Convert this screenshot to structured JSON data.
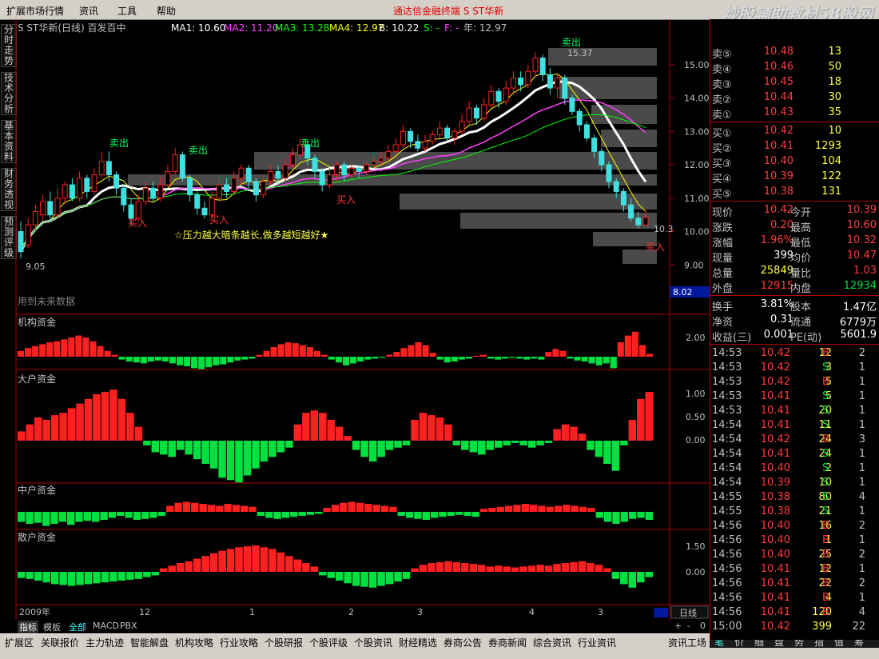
{
  "menu": {
    "items": [
      "扩展市场行情",
      "资讯",
      "工具",
      "帮助"
    ],
    "title": "通达信金融终端  S  ST华新",
    "watermark": "炒股辅助教材58股网",
    "watermark_url": "www.58Gu.com"
  },
  "left_tabs": [
    "分时走势",
    "技术分析",
    "基本资料",
    "财务透视",
    "预测评级"
  ],
  "header": {
    "stock": "S ST华新(日线) 百发百中",
    "ma1": "MA1: 10.60",
    "ma2": "MA2: 11.20",
    "ma3": "MA3: 13.28",
    "ma4": "MA4: 12.97",
    "b": "B: 10.22",
    "s": "S: -",
    "f": "F: -",
    "year": "年: 12.97"
  },
  "main_chart": {
    "price_axis": [
      "15.00",
      "14.00",
      "13.00",
      "12.00",
      "11.00",
      "10.00",
      "9.00",
      "8.00"
    ],
    "current_price_box": "8.02",
    "high_label": "15.37",
    "low_label": "9.05",
    "last_label": "10.3",
    "sell_label": "卖出",
    "buy_label": "买入",
    "slogan": "☆压力越大暗条越长,做多越短越好★",
    "future_note": "用到未来数据"
  },
  "indicators": [
    {
      "name": "机构资金",
      "axis": [
        "2.00"
      ]
    },
    {
      "name": "大户资金",
      "axis": [
        "1.00",
        "0.50",
        "0.00"
      ]
    },
    {
      "name": "中户资金",
      "axis": []
    },
    {
      "name": "散户资金",
      "axis": [
        "1.50",
        "0.00"
      ]
    }
  ],
  "time_axis": [
    "2009年",
    "12",
    "1",
    "2",
    "3",
    "4",
    "3"
  ],
  "period_label": "日线",
  "zoom": [
    "+",
    "-",
    "0"
  ],
  "bottom_tabs": [
    "指标",
    "模板",
    "全部",
    "MACD",
    "PBX"
  ],
  "func_bar": [
    "扩展区",
    "关联报价",
    "主力轨迹",
    "智能解盘",
    "机构攻略",
    "行业攻略",
    "个股研报",
    "个股评级",
    "个股资讯",
    "财经精选",
    "券商公告",
    "券商新闻",
    "综合资讯",
    "行业资讯",
    "资讯工场"
  ],
  "panel_tabs": [
    "笔",
    "价",
    "细",
    "盘",
    "势",
    "指",
    "值",
    "筹"
  ],
  "order_book": {
    "sell": [
      {
        "label": "卖⑤",
        "price": "10.48",
        "vol": "13"
      },
      {
        "label": "卖④",
        "price": "10.46",
        "vol": "50"
      },
      {
        "label": "卖③",
        "price": "10.45",
        "vol": "18"
      },
      {
        "label": "卖②",
        "price": "10.44",
        "vol": "30"
      },
      {
        "label": "卖①",
        "price": "10.43",
        "vol": "35"
      }
    ],
    "buy": [
      {
        "label": "买①",
        "price": "10.42",
        "vol": "10"
      },
      {
        "label": "买②",
        "price": "10.41",
        "vol": "1293"
      },
      {
        "label": "买③",
        "price": "10.40",
        "vol": "104"
      },
      {
        "label": "买④",
        "price": "10.39",
        "vol": "122"
      },
      {
        "label": "买⑤",
        "price": "10.38",
        "vol": "131"
      }
    ]
  },
  "stats": [
    {
      "l1": "现价",
      "v1": "10.42",
      "c1": "red",
      "l2": "今开",
      "v2": "10.39",
      "c2": "red"
    },
    {
      "l1": "涨跌",
      "v1": "0.20",
      "c1": "red",
      "l2": "最高",
      "v2": "10.60",
      "c2": "red"
    },
    {
      "l1": "涨幅",
      "v1": "1.96%",
      "c1": "red",
      "l2": "最低",
      "v2": "10.32",
      "c2": "red"
    },
    {
      "l1": "现量",
      "v1": "399",
      "c1": "wht",
      "l2": "均价",
      "v2": "10.47",
      "c2": "red"
    },
    {
      "l1": "总量",
      "v1": "25849",
      "c1": "yel",
      "l2": "量比",
      "v2": "1.03",
      "c2": "red"
    },
    {
      "l1": "外盘",
      "v1": "12915",
      "c1": "red",
      "l2": "内盘",
      "v2": "12934",
      "c2": "grn"
    }
  ],
  "stats2": [
    {
      "l1": "换手",
      "v1": "3.81%",
      "l2": "股本",
      "v2": "1.47亿"
    },
    {
      "l1": "净资",
      "v1": "0.31",
      "l2": "流通",
      "v2": "6779万"
    },
    {
      "l1": "收益(三)",
      "v1": "0.001",
      "l2": "PE(动)",
      "v2": "5601.9"
    }
  ],
  "ticks": [
    {
      "t": "14:53",
      "p": "10.42",
      "v": "12",
      "bs": "B",
      "n": "2"
    },
    {
      "t": "14:53",
      "p": "10.42",
      "v": "3",
      "bs": "S",
      "n": "1"
    },
    {
      "t": "14:53",
      "p": "10.42",
      "v": "5",
      "bs": "B",
      "n": "1"
    },
    {
      "t": "14:53",
      "p": "10.41",
      "v": "5",
      "bs": "S",
      "n": "1"
    },
    {
      "t": "14:53",
      "p": "10.41",
      "v": "20",
      "bs": "S",
      "n": "1"
    },
    {
      "t": "14:54",
      "p": "10.41",
      "v": "11",
      "bs": "S",
      "n": "1"
    },
    {
      "t": "14:54",
      "p": "10.42",
      "v": "24",
      "bs": "B",
      "n": "3"
    },
    {
      "t": "14:54",
      "p": "10.41",
      "v": "24",
      "bs": "S",
      "n": "1"
    },
    {
      "t": "14:54",
      "p": "10.40",
      "v": "2",
      "bs": "S",
      "n": "1"
    },
    {
      "t": "14:54",
      "p": "10.39",
      "v": "10",
      "bs": "S",
      "n": "1"
    },
    {
      "t": "14:55",
      "p": "10.38",
      "v": "80",
      "bs": "S",
      "n": "4"
    },
    {
      "t": "14:55",
      "p": "10.38",
      "v": "21",
      "bs": "S",
      "n": "1"
    },
    {
      "t": "14:56",
      "p": "10.40",
      "v": "16",
      "bs": "B",
      "n": "2"
    },
    {
      "t": "14:56",
      "p": "10.40",
      "v": "1",
      "bs": "B",
      "n": "1"
    },
    {
      "t": "14:56",
      "p": "10.40",
      "v": "25",
      "bs": "B",
      "n": "2"
    },
    {
      "t": "14:56",
      "p": "10.41",
      "v": "12",
      "bs": "B",
      "n": "1"
    },
    {
      "t": "14:56",
      "p": "10.41",
      "v": "22",
      "bs": "B",
      "n": "2"
    },
    {
      "t": "14:56",
      "p": "10.41",
      "v": "4",
      "bs": "B",
      "n": "1"
    },
    {
      "t": "14:56",
      "p": "10.41",
      "v": "120",
      "bs": "B",
      "n": "4"
    },
    {
      "t": "15:00",
      "p": "10.42",
      "v": "399",
      "bs": "",
      "n": "22"
    }
  ],
  "colors": {
    "up": "#ff2020",
    "down": "#00e040",
    "ma1": "#ffffff",
    "ma2": "#ff40ff",
    "ma3": "#00ff00",
    "ma4": "#ffff00",
    "band": "#4a4a4a"
  },
  "candles": [
    [
      10.0,
      9.4,
      10.3,
      9.2
    ],
    [
      9.6,
      10.2,
      10.4,
      9.5
    ],
    [
      10.2,
      10.6,
      10.8,
      10.0
    ],
    [
      10.5,
      10.9,
      11.1,
      10.3
    ],
    [
      10.9,
      10.5,
      11.2,
      10.3
    ],
    [
      10.5,
      11.0,
      11.3,
      10.4
    ],
    [
      11.0,
      11.4,
      11.5,
      10.8
    ],
    [
      11.4,
      11.0,
      11.6,
      10.9
    ],
    [
      11.0,
      11.6,
      11.8,
      10.9
    ],
    [
      11.6,
      11.2,
      11.7,
      11.0
    ],
    [
      11.2,
      11.7,
      11.9,
      11.1
    ],
    [
      11.7,
      12.1,
      12.4,
      11.6
    ],
    [
      12.1,
      11.7,
      12.4,
      11.5
    ],
    [
      11.7,
      11.3,
      11.8,
      11.1
    ],
    [
      11.3,
      10.8,
      11.4,
      10.6
    ],
    [
      10.8,
      10.4,
      11.0,
      10.2
    ],
    [
      10.4,
      10.9,
      11.1,
      10.3
    ],
    [
      10.9,
      11.3,
      11.5,
      10.8
    ],
    [
      11.3,
      11.0,
      11.5,
      10.9
    ],
    [
      11.0,
      11.4,
      11.6,
      10.9
    ],
    [
      11.4,
      11.8,
      12.0,
      11.3
    ],
    [
      11.8,
      12.3,
      12.5,
      11.7
    ],
    [
      12.3,
      11.6,
      12.4,
      11.5
    ],
    [
      11.6,
      11.1,
      11.7,
      10.9
    ],
    [
      11.1,
      10.7,
      11.2,
      10.5
    ],
    [
      10.7,
      10.5,
      10.9,
      10.4
    ],
    [
      10.5,
      11.0,
      11.2,
      10.4
    ],
    [
      11.0,
      11.4,
      11.6,
      10.9
    ],
    [
      11.4,
      11.2,
      11.6,
      11.0
    ],
    [
      11.2,
      11.6,
      11.8,
      11.1
    ],
    [
      11.6,
      11.9,
      12.0,
      11.4
    ],
    [
      11.9,
      11.5,
      12.0,
      11.3
    ],
    [
      11.5,
      11.1,
      11.6,
      10.9
    ],
    [
      11.1,
      11.5,
      11.7,
      11.0
    ],
    [
      11.5,
      11.8,
      12.0,
      11.4
    ],
    [
      11.8,
      11.6,
      12.0,
      11.4
    ],
    [
      11.6,
      12.0,
      12.2,
      11.5
    ],
    [
      12.0,
      12.3,
      12.5,
      11.9
    ],
    [
      12.3,
      12.6,
      12.8,
      12.2
    ],
    [
      12.6,
      12.2,
      12.7,
      12.0
    ],
    [
      12.2,
      11.8,
      12.3,
      11.6
    ],
    [
      11.8,
      11.4,
      11.9,
      11.2
    ],
    [
      11.4,
      11.7,
      11.9,
      11.3
    ],
    [
      11.7,
      12.0,
      12.1,
      11.5
    ],
    [
      12.0,
      11.7,
      12.1,
      11.5
    ],
    [
      11.7,
      11.9,
      12.0,
      11.6
    ],
    [
      11.9,
      11.8,
      12.0,
      11.6
    ],
    [
      11.8,
      12.0,
      12.1,
      11.7
    ],
    [
      12.0,
      12.1,
      12.3,
      11.9
    ],
    [
      12.1,
      12.2,
      12.4,
      12.0
    ],
    [
      12.2,
      12.4,
      12.6,
      12.1
    ],
    [
      12.4,
      12.6,
      12.8,
      12.3
    ],
    [
      12.6,
      13.0,
      13.2,
      12.5
    ],
    [
      13.0,
      12.7,
      13.1,
      12.5
    ],
    [
      12.7,
      12.5,
      12.9,
      12.4
    ],
    [
      12.5,
      12.7,
      12.9,
      12.4
    ],
    [
      12.7,
      12.9,
      13.0,
      12.6
    ],
    [
      12.9,
      13.1,
      13.3,
      12.8
    ],
    [
      13.1,
      12.8,
      13.2,
      12.7
    ],
    [
      12.8,
      13.0,
      13.1,
      12.6
    ],
    [
      13.0,
      13.3,
      13.5,
      12.9
    ],
    [
      13.3,
      13.7,
      13.9,
      13.2
    ],
    [
      13.7,
      13.4,
      13.8,
      13.2
    ],
    [
      13.4,
      13.8,
      14.0,
      13.3
    ],
    [
      13.8,
      14.2,
      14.4,
      13.7
    ],
    [
      14.2,
      13.9,
      14.3,
      13.7
    ],
    [
      13.9,
      14.3,
      14.5,
      13.8
    ],
    [
      14.3,
      14.6,
      14.8,
      14.1
    ],
    [
      14.6,
      14.4,
      14.8,
      14.2
    ],
    [
      14.4,
      14.8,
      15.0,
      14.3
    ],
    [
      14.8,
      15.2,
      15.37,
      14.6
    ],
    [
      15.2,
      14.7,
      15.3,
      14.5
    ],
    [
      14.7,
      14.3,
      14.9,
      14.1
    ],
    [
      14.3,
      14.6,
      14.7,
      14.0
    ],
    [
      14.6,
      14.0,
      14.7,
      13.8
    ],
    [
      14.0,
      13.6,
      14.1,
      13.5
    ],
    [
      13.6,
      13.2,
      13.7,
      13.0
    ],
    [
      13.2,
      12.8,
      13.3,
      12.7
    ],
    [
      12.8,
      12.4,
      12.9,
      12.2
    ],
    [
      12.4,
      12.0,
      12.5,
      11.8
    ],
    [
      12.0,
      11.5,
      12.1,
      11.3
    ],
    [
      11.5,
      11.2,
      11.6,
      11.0
    ],
    [
      11.2,
      10.8,
      11.3,
      10.6
    ],
    [
      10.8,
      10.4,
      11.0,
      10.3
    ],
    [
      10.4,
      10.2,
      10.6,
      10.1
    ],
    [
      10.2,
      10.42,
      10.6,
      10.32
    ]
  ],
  "ind1": [
    0.6,
    0.9,
    1.1,
    1.3,
    1.5,
    1.6,
    1.8,
    2.0,
    2.2,
    2.0,
    1.6,
    1.1,
    0.6,
    0.2,
    -0.3,
    -0.5,
    -0.6,
    -0.7,
    -0.5,
    -0.4,
    -0.5,
    -0.7,
    -0.9,
    -1.0,
    -1.2,
    -1.3,
    -1.1,
    -0.9,
    -0.8,
    -0.6,
    -0.4,
    -0.3,
    -0.2,
    0.2,
    0.6,
    1.0,
    1.3,
    1.5,
    1.4,
    1.2,
    1.0,
    0.6,
    0.2,
    -0.3,
    -0.6,
    -0.9,
    -0.7,
    -0.5,
    -0.3,
    -0.2,
    -0.1,
    0.2,
    0.5,
    0.9,
    1.2,
    1.5,
    1.2,
    0.4,
    -0.3,
    -0.6,
    -0.5,
    -0.3,
    -0.2,
    0.1,
    0.2,
    -0.2,
    -0.3,
    -0.2,
    -0.1,
    -0.2,
    -0.3,
    -0.2,
    -0.3,
    0.5,
    0.8,
    0.6,
    -0.2,
    -0.4,
    -0.5,
    -0.7,
    -0.9,
    -0.7,
    -1.2,
    1.5,
    2.2,
    2.6,
    1.2,
    0.3
  ],
  "ind2": [
    0.2,
    0.35,
    0.5,
    0.45,
    0.55,
    0.6,
    0.7,
    0.8,
    0.9,
    1.0,
    1.05,
    1.1,
    0.9,
    0.6,
    0.3,
    -0.1,
    -0.25,
    -0.3,
    -0.35,
    -0.2,
    -0.3,
    -0.4,
    -0.5,
    -0.6,
    -0.8,
    -0.85,
    -0.9,
    -0.75,
    -0.6,
    -0.45,
    -0.35,
    -0.25,
    -0.15,
    0.35,
    0.6,
    0.65,
    0.6,
    0.45,
    0.3,
    0.1,
    -0.2,
    -0.35,
    -0.45,
    -0.35,
    -0.2,
    -0.15,
    -0.1,
    0.45,
    0.6,
    0.55,
    0.5,
    0.35,
    -0.1,
    -0.2,
    -0.25,
    -0.3,
    -0.2,
    -0.15,
    -0.1,
    -0.05,
    -0.1,
    -0.15,
    -0.1,
    -0.05,
    0.25,
    0.35,
    0.3,
    0.15,
    -0.2,
    -0.35,
    -0.5,
    -0.65,
    -0.1,
    0.45,
    0.9,
    1.05
  ],
  "ind3": [
    -0.5,
    -0.6,
    -0.55,
    -0.7,
    -0.6,
    -0.5,
    -0.65,
    -0.5,
    -0.45,
    -0.5,
    -0.4,
    -0.3,
    -0.2,
    -0.3,
    -0.4,
    -0.35,
    -0.3,
    -0.2,
    0.3,
    0.45,
    0.5,
    0.45,
    0.4,
    0.35,
    0.3,
    0.4,
    0.35,
    0.3,
    0.25,
    -0.2,
    -0.3,
    -0.35,
    -0.3,
    -0.25,
    -0.2,
    -0.15,
    -0.1,
    0.2,
    0.35,
    0.45,
    0.5,
    0.45,
    0.4,
    0.35,
    0.3,
    0.25,
    -0.2,
    -0.3,
    -0.35,
    -0.4,
    -0.3,
    -0.25,
    -0.2,
    -0.15,
    -0.2,
    -0.25,
    0.15,
    0.2,
    0.25,
    0.3,
    0.35,
    0.4,
    0.35,
    0.3,
    0.25,
    0.3,
    0.35,
    0.3,
    0.25,
    0.2,
    -0.3,
    -0.5,
    -0.6,
    -0.5,
    -0.35,
    -0.3,
    -0.4
  ],
  "ind4": [
    -0.35,
    -0.4,
    -0.5,
    -0.6,
    -0.7,
    -0.75,
    -0.8,
    -0.75,
    -0.7,
    -0.65,
    -0.6,
    -0.55,
    -0.5,
    -0.45,
    -0.4,
    -0.3,
    -0.2,
    0.2,
    0.35,
    0.5,
    0.6,
    0.75,
    0.9,
    1.05,
    1.2,
    1.3,
    1.4,
    1.45,
    1.5,
    1.4,
    1.3,
    1.1,
    0.9,
    0.7,
    0.5,
    0.3,
    -0.2,
    -0.35,
    -0.5,
    -0.65,
    -0.8,
    -0.85,
    -0.9,
    -0.8,
    -0.7,
    -0.55,
    -0.4,
    0.2,
    0.4,
    0.5,
    0.55,
    0.6,
    0.55,
    0.5,
    0.45,
    0.4,
    0.3,
    0.35,
    0.3,
    0.25,
    0.3,
    0.35,
    0.4,
    0.35,
    0.45,
    0.5,
    0.55,
    0.6,
    0.5,
    0.4,
    0.2,
    -0.4,
    -0.7,
    -0.9,
    -0.6,
    -0.3
  ]
}
